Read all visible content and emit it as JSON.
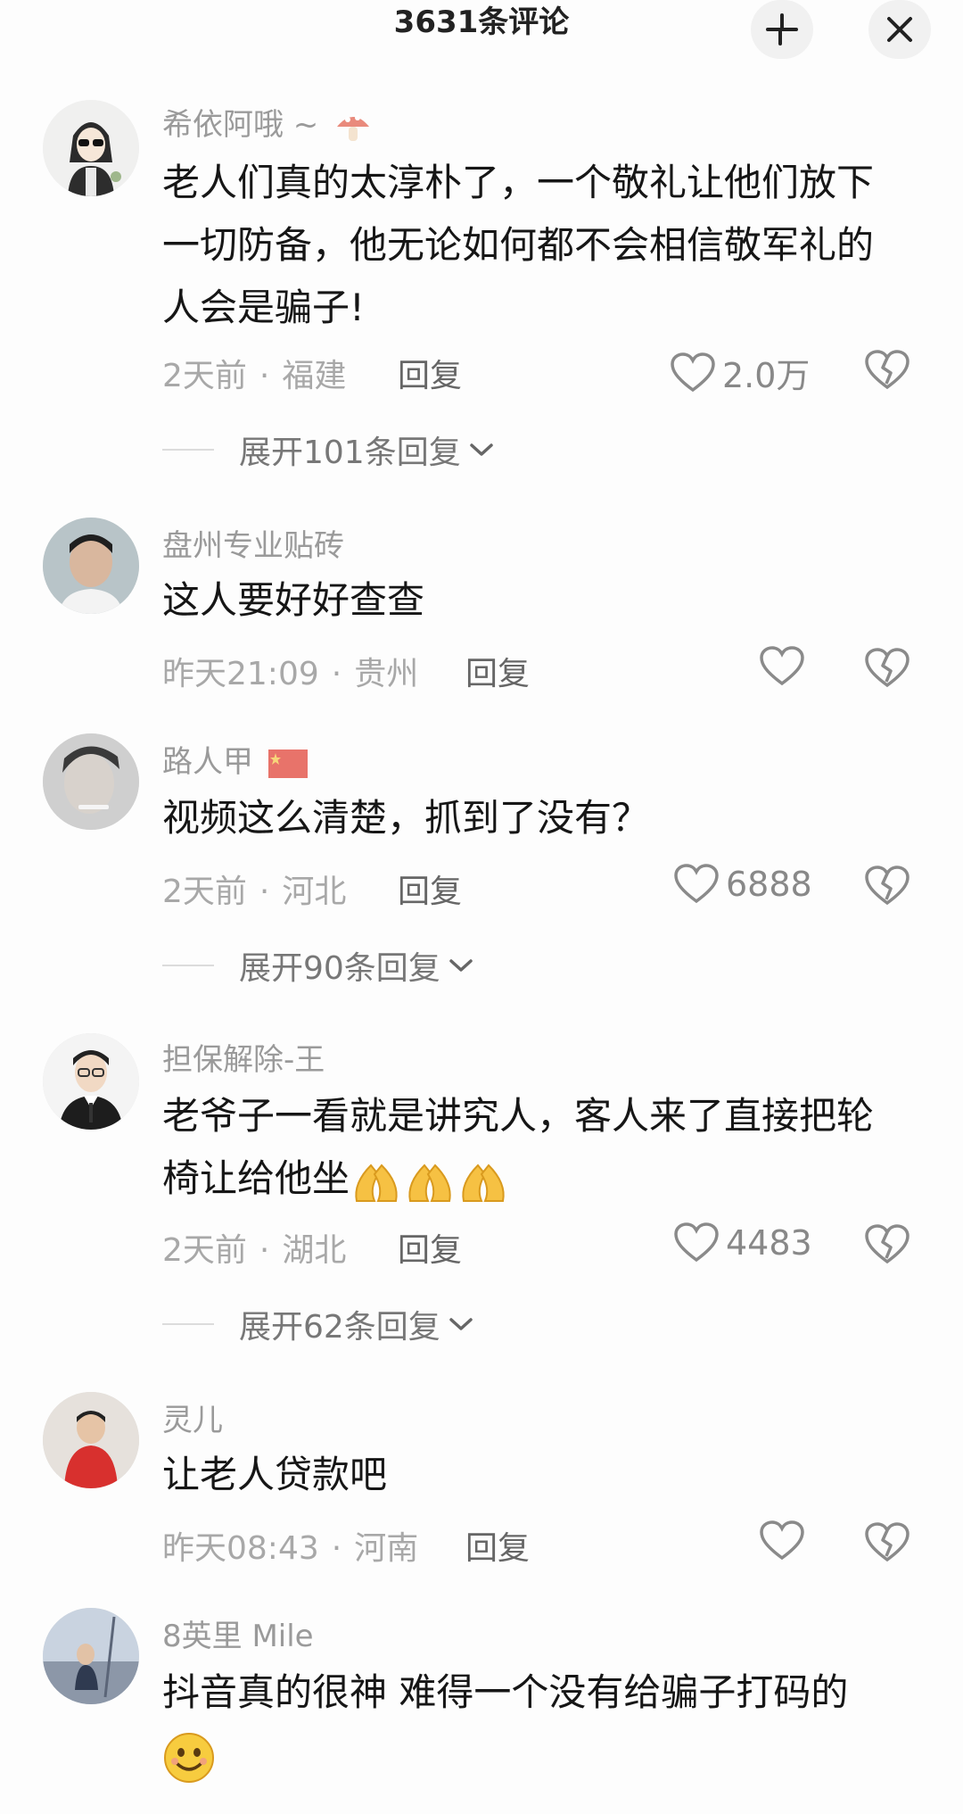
{
  "header": {
    "title": "3631条评论",
    "collapse_icon": "collapse-icon",
    "close_icon": "close-icon"
  },
  "comments": [
    {
      "user": "希依阿哦 ~",
      "badge_icon": "mushroom-icon",
      "text": "老人们真的太淳朴了，一个敬礼让他们放下一切防备，他无论如何都不会相信敬军礼的人会是骗子!",
      "time": "2天前",
      "region": "福建",
      "reply": "回复",
      "likes": "2.0万",
      "expand": "展开101条回复"
    },
    {
      "user": "盘州专业贴砖",
      "text": "这人要好好查查",
      "time": "昨天21:09",
      "region": "贵州",
      "reply": "回复",
      "likes": ""
    },
    {
      "user": "路人甲",
      "badge_icon": "china-flag-icon",
      "text": "视频这么清楚，抓到了没有？",
      "time": "2天前",
      "region": "河北",
      "reply": "回复",
      "likes": "6888",
      "expand": "展开90条回复"
    },
    {
      "user": "担保解除-王",
      "text": "老爷子一看就是讲究人，客人来了直接把轮椅让给他坐",
      "emoji_icon": "folded-hands-icon",
      "time": "2天前",
      "region": "湖北",
      "reply": "回复",
      "likes": "4483",
      "expand": "展开62条回复"
    },
    {
      "user": "灵儿",
      "text": "让老人贷款吧",
      "time": "昨天08:43",
      "region": "河南",
      "reply": "回复",
      "likes": ""
    },
    {
      "user": "8英里 Mile",
      "text": "抖音真的很神 难得一个没有给骗子打码的",
      "emoji_icon": "smiling-face-icon"
    }
  ],
  "colors": {
    "background": "#fdfdfd",
    "meta_gray": "#a8a8a8",
    "name_gray": "#9a9a9a"
  }
}
